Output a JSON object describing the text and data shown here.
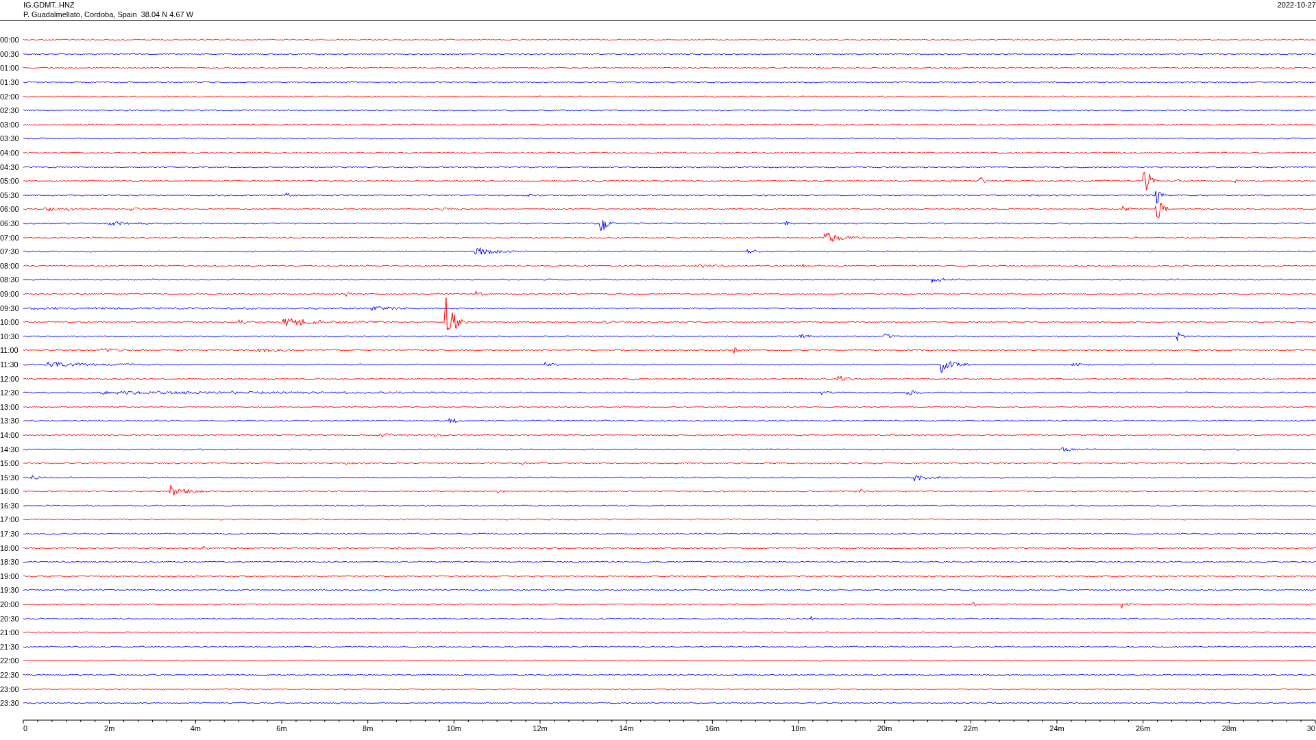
{
  "header": {
    "channel": "IG.GDMT..HNZ",
    "station": "P. Guadalmellato, Cordoba, Spain  38.04 N 4.67 W",
    "date": "2022-10-27"
  },
  "traces": [
    {
      "time": "00:00",
      "color": "#ff0000"
    },
    {
      "time": "00:30",
      "color": "#0000ff"
    },
    {
      "time": "01:00",
      "color": "#ff0000"
    },
    {
      "time": "01:30",
      "color": "#0000ff"
    },
    {
      "time": "02:00",
      "color": "#ff0000"
    },
    {
      "time": "02:30",
      "color": "#0000ff"
    },
    {
      "time": "03:00",
      "color": "#ff0000"
    },
    {
      "time": "03:30",
      "color": "#0000ff"
    },
    {
      "time": "04:00",
      "color": "#ff0000"
    },
    {
      "time": "04:30",
      "color": "#0000ff"
    },
    {
      "time": "05:00",
      "color": "#ff0000"
    },
    {
      "time": "05:30",
      "color": "#0000ff"
    },
    {
      "time": "06:00",
      "color": "#ff0000"
    },
    {
      "time": "06:30",
      "color": "#0000ff"
    },
    {
      "time": "07:00",
      "color": "#ff0000"
    },
    {
      "time": "07:30",
      "color": "#0000ff"
    },
    {
      "time": "08:00",
      "color": "#ff0000"
    },
    {
      "time": "08:30",
      "color": "#0000ff"
    },
    {
      "time": "09:00",
      "color": "#ff0000"
    },
    {
      "time": "09:30",
      "color": "#0000ff"
    },
    {
      "time": "10:00",
      "color": "#ff0000"
    },
    {
      "time": "10:30",
      "color": "#0000ff"
    },
    {
      "time": "11:00",
      "color": "#ff0000"
    },
    {
      "time": "11:30",
      "color": "#0000ff"
    },
    {
      "time": "12:00",
      "color": "#ff0000"
    },
    {
      "time": "12:30",
      "color": "#0000ff"
    },
    {
      "time": "13:00",
      "color": "#ff0000"
    },
    {
      "time": "13:30",
      "color": "#0000ff"
    },
    {
      "time": "14:00",
      "color": "#ff0000"
    },
    {
      "time": "14:30",
      "color": "#0000ff"
    },
    {
      "time": "15:00",
      "color": "#ff0000"
    },
    {
      "time": "15:30",
      "color": "#0000ff"
    },
    {
      "time": "16:00",
      "color": "#ff0000"
    },
    {
      "time": "16:30",
      "color": "#0000ff"
    },
    {
      "time": "17:00",
      "color": "#ff0000"
    },
    {
      "time": "17:30",
      "color": "#0000ff"
    },
    {
      "time": "18:00",
      "color": "#ff0000"
    },
    {
      "time": "18:30",
      "color": "#0000ff"
    },
    {
      "time": "19:00",
      "color": "#ff0000"
    },
    {
      "time": "19:30",
      "color": "#0000ff"
    },
    {
      "time": "20:00",
      "color": "#ff0000"
    },
    {
      "time": "20:30",
      "color": "#0000ff"
    },
    {
      "time": "21:00",
      "color": "#ff0000"
    },
    {
      "time": "21:30",
      "color": "#0000ff"
    },
    {
      "time": "22:00",
      "color": "#ff0000"
    },
    {
      "time": "22:30",
      "color": "#0000ff"
    },
    {
      "time": "23:00",
      "color": "#ff0000"
    },
    {
      "time": "23:30",
      "color": "#0000ff"
    }
  ],
  "x_axis": {
    "labels": [
      "0",
      "2m",
      "4m",
      "6m",
      "8m",
      "10m",
      "12m",
      "14m",
      "16m",
      "18m",
      "20m",
      "22m",
      "24m",
      "26m",
      "28m",
      "30"
    ]
  }
}
